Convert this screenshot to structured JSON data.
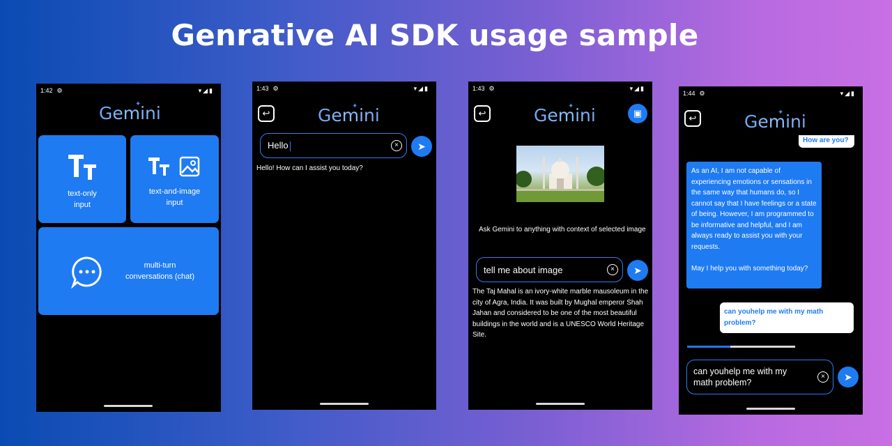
{
  "headline": "Genrative AI SDK usage sample",
  "logo_text": "Gemini",
  "phones": [
    {
      "time": "1:42",
      "tiles": {
        "text_only": {
          "label_line1": "text-only",
          "label_line2": "input",
          "icon_text": "TT"
        },
        "text_image": {
          "label_line1": "text-and-image",
          "label_line2": "input",
          "icon_text": "TT"
        },
        "chat": {
          "label_line1": "multi-turn",
          "label_line2": "conversations (chat)",
          "icon_text": "···"
        }
      }
    },
    {
      "time": "1:43",
      "input_value": "Hello",
      "response": "Hello! How can I assist you today?"
    },
    {
      "time": "1:43",
      "prompt_hint": "Ask Gemini to anything with context of selected image",
      "input_value": "tell me about image",
      "response": " The Taj Mahal is an ivory-white marble mausoleum in the city of Agra, India. It was built by Mughal emperor Shah Jahan and considered to be one of the most beautiful buildings in the world and is a UNESCO World Heritage Site."
    },
    {
      "time": "1:44",
      "partial_user_msg": "How are you?",
      "model_msg_p1": "As an AI, I am not capable of experiencing emotions or sensations in the same way that humans do, so I cannot say that I have feelings or a state of being. However, I am programmed to be informative and helpful, and I am always ready to assist you with your requests.",
      "model_msg_p2": "May I help you with something today?",
      "user_msg": "can youhelp me with my math problem?",
      "progress": 0.4,
      "input_value": "can youhelp me with my math problem?"
    }
  ],
  "icons": {
    "send": "send-icon",
    "clear": "clear-icon",
    "back": "back-icon",
    "add_image": "add-image-icon",
    "settings": "gear-icon",
    "wifi": "wifi-icon",
    "signal": "signal-icon",
    "battery": "battery-icon"
  },
  "colors": {
    "accent": "#1f7bf2",
    "background": "#000000",
    "border": "#2b7ff5"
  }
}
